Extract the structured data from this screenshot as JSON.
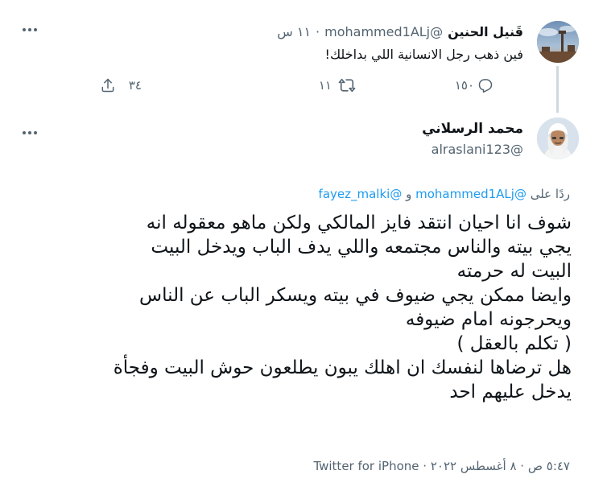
{
  "parent_tweet": {
    "display_name": "قَنيل الحنين",
    "handle": "@mohammed1ALj",
    "separator": "·",
    "time": "١١ س",
    "text": "فين ذهب رجل الانسانية اللي بداخلك!",
    "actions": {
      "reply_count": "",
      "retweet_count": "١١",
      "like_count": "١٥٠",
      "share_count": "٣٤"
    }
  },
  "main_tweet": {
    "display_name": "محمد الرسلاني",
    "handle": "@alraslani123",
    "replying_prefix": "ردًا على",
    "replying_mention_1": "@mohammed1ALj",
    "replying_and": "و",
    "replying_mention_2": "@fayez_malki",
    "text_lines": [
      "شوف انا احيان انتقد فايز المالكي ولكن ماهو معقوله انه",
      "يجي بيته والناس مجتمعه واللي يدف الباب ويدخل البيت",
      " البيت له حرمته",
      "وايضا ممكن يجي ضيوف في بيته ويسكر الباب عن الناس",
      "ويحرجونه امام ضيوفه",
      "( تكلم بالعقل )",
      "هل ترضاها لنفسك ان اهلك يبون يطلعون حوش البيت وفجأة",
      "يدخل عليهم احد"
    ],
    "time": "٥:٤٧ ص",
    "date": "٨ أغسطس ٢٠٢٢",
    "source": "Twitter for iPhone"
  },
  "icons": {
    "more": "more-dots-icon",
    "reply": "reply-icon",
    "retweet": "retweet-icon",
    "like": "like-icon",
    "share": "share-icon"
  },
  "colors": {
    "text": "#0f1419",
    "secondary": "#536471",
    "link": "#1d9bf0",
    "thread_line": "#cfd9de"
  }
}
